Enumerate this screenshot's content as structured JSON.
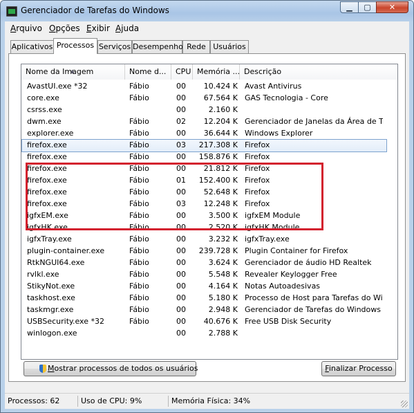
{
  "window": {
    "title": "Gerenciador de Tarefas do Windows",
    "controls": {
      "minimize": "▁",
      "maximize": "▢",
      "close": "✕"
    }
  },
  "menu": [
    {
      "underline": "A",
      "rest": "rquivo"
    },
    {
      "underline": "O",
      "rest": "pções"
    },
    {
      "underline": "E",
      "rest": "xibir"
    },
    {
      "underline": "Aj",
      "rest": "uda"
    }
  ],
  "tabs": [
    "Aplicativos",
    "Processos",
    "Serviços",
    "Desempenho",
    "Rede",
    "Usuários"
  ],
  "active_tab": "Processos",
  "columns": [
    "Nome da Imagem",
    "Nome d...",
    "CPU",
    "Memória ...",
    "Descrição"
  ],
  "processes": [
    {
      "name": "AvastUI.exe *32",
      "user": "Fábio",
      "cpu": "00",
      "mem": "10.424 K",
      "desc": "Avast Antivirus"
    },
    {
      "name": "core.exe",
      "user": "Fábio",
      "cpu": "00",
      "mem": "67.564 K",
      "desc": "GAS Tecnologia - Core"
    },
    {
      "name": "csrss.exe",
      "user": "",
      "cpu": "00",
      "mem": "2.160 K",
      "desc": ""
    },
    {
      "name": "dwm.exe",
      "user": "Fábio",
      "cpu": "02",
      "mem": "12.204 K",
      "desc": "Gerenciador de Janelas da Área de Tr..."
    },
    {
      "name": "explorer.exe",
      "user": "Fábio",
      "cpu": "00",
      "mem": "36.644 K",
      "desc": "Windows Explorer"
    },
    {
      "name": "firefox.exe",
      "user": "Fábio",
      "cpu": "03",
      "mem": "217.308 K",
      "desc": "Firefox",
      "selected": true
    },
    {
      "name": "firefox.exe",
      "user": "Fábio",
      "cpu": "00",
      "mem": "158.876 K",
      "desc": "Firefox"
    },
    {
      "name": "firefox.exe",
      "user": "Fábio",
      "cpu": "00",
      "mem": "21.812 K",
      "desc": "Firefox"
    },
    {
      "name": "firefox.exe",
      "user": "Fábio",
      "cpu": "01",
      "mem": "152.400 K",
      "desc": "Firefox"
    },
    {
      "name": "firefox.exe",
      "user": "Fábio",
      "cpu": "00",
      "mem": "52.648 K",
      "desc": "Firefox"
    },
    {
      "name": "firefox.exe",
      "user": "Fábio",
      "cpu": "03",
      "mem": "12.248 K",
      "desc": "Firefox"
    },
    {
      "name": "igfxEM.exe",
      "user": "Fábio",
      "cpu": "00",
      "mem": "3.500 K",
      "desc": "igfxEM Module"
    },
    {
      "name": "igfxHK.exe",
      "user": "Fábio",
      "cpu": "00",
      "mem": "2.520 K",
      "desc": "igfxHK Module"
    },
    {
      "name": "igfxTray.exe",
      "user": "Fábio",
      "cpu": "00",
      "mem": "3.232 K",
      "desc": "igfxTray.exe"
    },
    {
      "name": "plugin-container.exe",
      "user": "Fábio",
      "cpu": "00",
      "mem": "239.728 K",
      "desc": "Plugin Container for Firefox"
    },
    {
      "name": "RtkNGUI64.exe",
      "user": "Fábio",
      "cpu": "00",
      "mem": "3.624 K",
      "desc": "Gerenciador de áudio HD Realtek"
    },
    {
      "name": "rvlkl.exe",
      "user": "Fábio",
      "cpu": "00",
      "mem": "5.548 K",
      "desc": "Revealer Keylogger Free"
    },
    {
      "name": "StikyNot.exe",
      "user": "Fábio",
      "cpu": "00",
      "mem": "4.164 K",
      "desc": "Notas Autoadesivas"
    },
    {
      "name": "taskhost.exe",
      "user": "Fábio",
      "cpu": "00",
      "mem": "5.180 K",
      "desc": "Processo de Host para Tarefas do Win..."
    },
    {
      "name": "taskmgr.exe",
      "user": "Fábio",
      "cpu": "00",
      "mem": "2.948 K",
      "desc": "Gerenciador de Tarefas do Windows"
    },
    {
      "name": "USBSecurity.exe *32",
      "user": "Fábio",
      "cpu": "00",
      "mem": "40.676 K",
      "desc": "Free USB Disk Security"
    },
    {
      "name": "winlogon.exe",
      "user": "",
      "cpu": "00",
      "mem": "2.788 K",
      "desc": ""
    }
  ],
  "buttons": {
    "show_all": {
      "underline": "M",
      "rest": "ostrar processos de todos os usuários"
    },
    "end_process": {
      "underline": "F",
      "rest": "inalizar Processo"
    }
  },
  "status": {
    "processes": "Processos: 62",
    "cpu": "Uso de CPU: 9%",
    "memory": "Memória Física: 34%"
  },
  "colors": {
    "highlight_box": "#d3202e",
    "selection": "#7da2ce"
  }
}
